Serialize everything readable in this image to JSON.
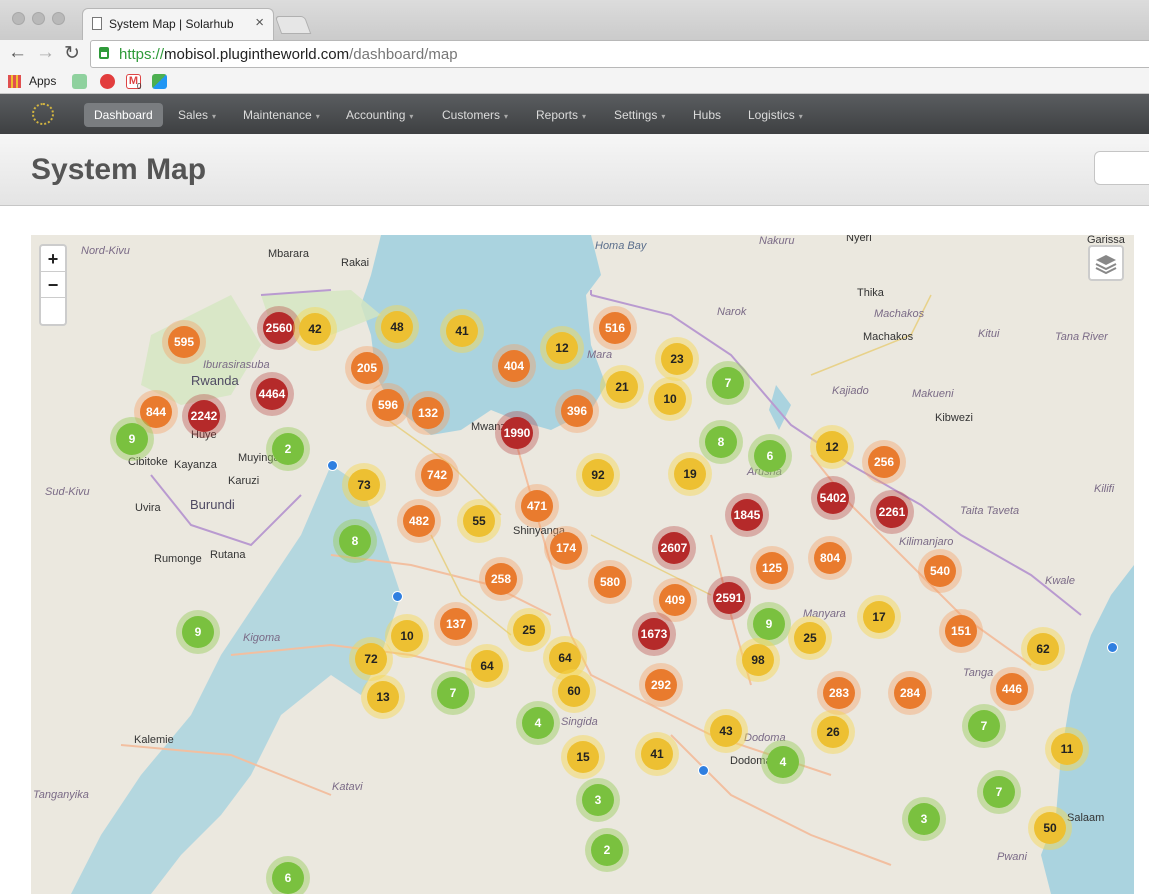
{
  "browser": {
    "tab_title": "System Map | Solarhub",
    "url_scheme": "https://",
    "url_host": "mobisol.plugintheworld.com",
    "url_path": "/dashboard/map",
    "apps_label": "Apps",
    "gmail_count": "0"
  },
  "nav": {
    "items": [
      {
        "label": "Dashboard",
        "active": true,
        "caret": false
      },
      {
        "label": "Sales",
        "caret": true
      },
      {
        "label": "Maintenance",
        "caret": true
      },
      {
        "label": "Accounting",
        "caret": true
      },
      {
        "label": "Customers",
        "caret": true
      },
      {
        "label": "Reports",
        "caret": true
      },
      {
        "label": "Settings",
        "caret": true
      },
      {
        "label": "Hubs",
        "caret": false
      },
      {
        "label": "Logistics",
        "caret": true
      }
    ]
  },
  "header": {
    "title": "System Map"
  },
  "map": {
    "zoom_in": "+",
    "zoom_out": "−",
    "labels": [
      {
        "t": "Nord-Kivu",
        "c": "region"
      },
      {
        "t": "Mbarara"
      },
      {
        "t": "Rakai"
      },
      {
        "t": "Homa Bay",
        "c": "water"
      },
      {
        "t": "Nakuru",
        "c": "region"
      },
      {
        "t": "Nyeri"
      },
      {
        "t": "Garissa"
      },
      {
        "t": "Thika"
      },
      {
        "t": "Machakos",
        "c": "region"
      },
      {
        "t": "Machakos"
      },
      {
        "t": "Kitui",
        "c": "region"
      },
      {
        "t": "Tana River",
        "c": "region"
      },
      {
        "t": "Narok",
        "c": "region"
      },
      {
        "t": "Rwanda",
        "c": "country"
      },
      {
        "t": "Iburasirasuba",
        "c": "region"
      },
      {
        "t": "Mara",
        "c": "region"
      },
      {
        "t": "Kajiado",
        "c": "region"
      },
      {
        "t": "Makueni",
        "c": "region"
      },
      {
        "t": "Kibwezi"
      },
      {
        "t": "Huye"
      },
      {
        "t": "Cibitoke"
      },
      {
        "t": "Kayanza"
      },
      {
        "t": "Muyinga"
      },
      {
        "t": "Karuzi"
      },
      {
        "t": "Sud-Kivu",
        "c": "region"
      },
      {
        "t": "Burundi",
        "c": "country"
      },
      {
        "t": "Uvira"
      },
      {
        "t": "Rutana"
      },
      {
        "t": "Rumonge"
      },
      {
        "t": "Shinyanga"
      },
      {
        "t": "Mwanza"
      },
      {
        "t": "Arusha",
        "c": "region"
      },
      {
        "t": "Kilifi",
        "c": "region"
      },
      {
        "t": "Taita Taveta",
        "c": "region"
      },
      {
        "t": "Kilimanjaro",
        "c": "region"
      },
      {
        "t": "Kwale",
        "c": "region"
      },
      {
        "t": "Kigoma",
        "c": "region"
      },
      {
        "t": "Manyara",
        "c": "region"
      },
      {
        "t": "Tanga",
        "c": "region"
      },
      {
        "t": "Singida",
        "c": "region"
      },
      {
        "t": "Dodoma",
        "c": "region"
      },
      {
        "t": "Dodoma"
      },
      {
        "t": "Kalemie"
      },
      {
        "t": "Katavi",
        "c": "region"
      },
      {
        "t": "Tanganyika",
        "c": "region"
      },
      {
        "t": "Salaam"
      },
      {
        "t": "Pwani",
        "c": "region"
      }
    ],
    "clusters": [
      {
        "n": "595",
        "c": "orange"
      },
      {
        "n": "2560",
        "c": "red"
      },
      {
        "n": "42",
        "c": "yellow"
      },
      {
        "n": "48",
        "c": "yellow"
      },
      {
        "n": "41",
        "c": "yellow"
      },
      {
        "n": "12",
        "c": "yellow"
      },
      {
        "n": "516",
        "c": "orange"
      },
      {
        "n": "205",
        "c": "orange"
      },
      {
        "n": "404",
        "c": "orange"
      },
      {
        "n": "23",
        "c": "yellow"
      },
      {
        "n": "7",
        "c": "green"
      },
      {
        "n": "21",
        "c": "yellow"
      },
      {
        "n": "10",
        "c": "yellow"
      },
      {
        "n": "4464",
        "c": "red"
      },
      {
        "n": "844",
        "c": "orange"
      },
      {
        "n": "2242",
        "c": "red"
      },
      {
        "n": "596",
        "c": "orange"
      },
      {
        "n": "132",
        "c": "orange"
      },
      {
        "n": "396",
        "c": "orange"
      },
      {
        "n": "9",
        "c": "green"
      },
      {
        "n": "2",
        "c": "green"
      },
      {
        "n": "1990",
        "c": "red"
      },
      {
        "n": "8",
        "c": "green"
      },
      {
        "n": "6",
        "c": "green"
      },
      {
        "n": "12",
        "c": "yellow"
      },
      {
        "n": "256",
        "c": "orange"
      },
      {
        "n": "73",
        "c": "yellow"
      },
      {
        "n": "742",
        "c": "orange"
      },
      {
        "n": "92",
        "c": "yellow"
      },
      {
        "n": "19",
        "c": "yellow"
      },
      {
        "n": "471",
        "c": "orange"
      },
      {
        "n": "482",
        "c": "orange"
      },
      {
        "n": "55",
        "c": "yellow"
      },
      {
        "n": "1845",
        "c": "red"
      },
      {
        "n": "5402",
        "c": "red"
      },
      {
        "n": "2261",
        "c": "red"
      },
      {
        "n": "8",
        "c": "green"
      },
      {
        "n": "174",
        "c": "orange"
      },
      {
        "n": "2607",
        "c": "red"
      },
      {
        "n": "804",
        "c": "orange"
      },
      {
        "n": "258",
        "c": "orange"
      },
      {
        "n": "580",
        "c": "orange"
      },
      {
        "n": "125",
        "c": "orange"
      },
      {
        "n": "540",
        "c": "orange"
      },
      {
        "n": "409",
        "c": "orange"
      },
      {
        "n": "2591",
        "c": "red"
      },
      {
        "n": "9",
        "c": "green"
      },
      {
        "n": "10",
        "c": "yellow"
      },
      {
        "n": "137",
        "c": "orange"
      },
      {
        "n": "25",
        "c": "yellow"
      },
      {
        "n": "1673",
        "c": "red"
      },
      {
        "n": "9",
        "c": "green"
      },
      {
        "n": "25",
        "c": "yellow"
      },
      {
        "n": "17",
        "c": "yellow"
      },
      {
        "n": "151",
        "c": "orange"
      },
      {
        "n": "62",
        "c": "yellow"
      },
      {
        "n": "72",
        "c": "yellow"
      },
      {
        "n": "64",
        "c": "yellow"
      },
      {
        "n": "64",
        "c": "yellow"
      },
      {
        "n": "98",
        "c": "yellow"
      },
      {
        "n": "13",
        "c": "yellow"
      },
      {
        "n": "7",
        "c": "green"
      },
      {
        "n": "60",
        "c": "yellow"
      },
      {
        "n": "292",
        "c": "orange"
      },
      {
        "n": "283",
        "c": "orange"
      },
      {
        "n": "284",
        "c": "orange"
      },
      {
        "n": "446",
        "c": "orange"
      },
      {
        "n": "4",
        "c": "green"
      },
      {
        "n": "43",
        "c": "yellow"
      },
      {
        "n": "26",
        "c": "yellow"
      },
      {
        "n": "7",
        "c": "green"
      },
      {
        "n": "15",
        "c": "yellow"
      },
      {
        "n": "41",
        "c": "yellow"
      },
      {
        "n": "4",
        "c": "green"
      },
      {
        "n": "11",
        "c": "yellow"
      },
      {
        "n": "3",
        "c": "green"
      },
      {
        "n": "3",
        "c": "green"
      },
      {
        "n": "7",
        "c": "green"
      },
      {
        "n": "50",
        "c": "yellow"
      },
      {
        "n": "2",
        "c": "green"
      },
      {
        "n": "6",
        "c": "green"
      }
    ]
  }
}
